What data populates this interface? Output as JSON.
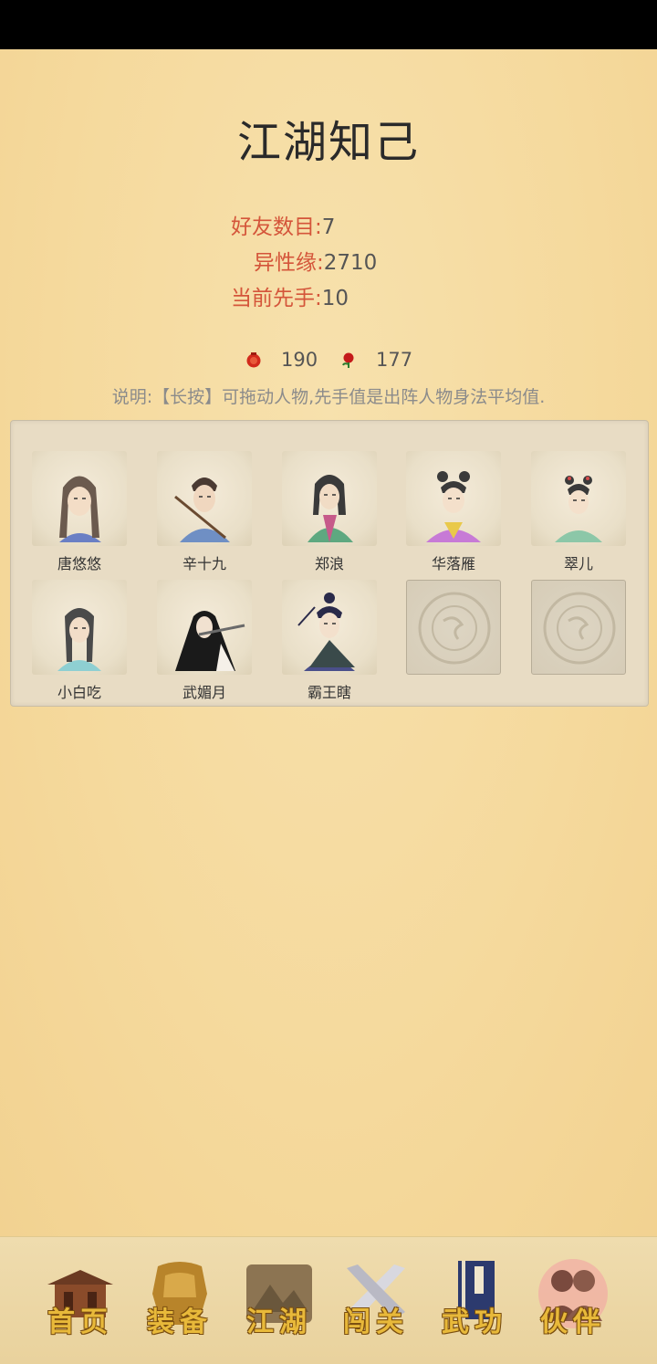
{
  "title": "江湖知己",
  "stats": {
    "friends_label": "好友数目:",
    "friends_value": "7",
    "affinity_label": "异性缘:",
    "affinity_value": "2710",
    "initiative_label": "当前先手:",
    "initiative_value": "10"
  },
  "resources": {
    "pouch_count": "190",
    "rose_count": "177"
  },
  "note": "说明:【长按】可拖动人物,先手值是出阵人物身法平均值.",
  "companions": [
    {
      "name": "唐悠悠",
      "icon": "portrait-woman-long-hair"
    },
    {
      "name": "辛十九",
      "icon": "portrait-swordsman"
    },
    {
      "name": "郑浪",
      "icon": "portrait-green-robe"
    },
    {
      "name": "华落雁",
      "icon": "portrait-purple-robe"
    },
    {
      "name": "翠儿",
      "icon": "portrait-maid"
    },
    {
      "name": "小白吃",
      "icon": "portrait-girl-braids"
    },
    {
      "name": "武媚月",
      "icon": "portrait-flute-player"
    },
    {
      "name": "霸王瞎",
      "icon": "portrait-fan-man"
    }
  ],
  "empty_slots": 2,
  "nav": [
    {
      "label": "首页",
      "icon": "house-icon"
    },
    {
      "label": "装备",
      "icon": "armor-icon"
    },
    {
      "label": "江湖",
      "icon": "scroll-map-icon"
    },
    {
      "label": "闯关",
      "icon": "swords-icon"
    },
    {
      "label": "武功",
      "icon": "book-icon"
    },
    {
      "label": "伙伴",
      "icon": "partners-icon"
    }
  ],
  "colors": {
    "stat_label": "#d4553a",
    "background": "#f7dba0",
    "nav_text": "#e8b93a"
  }
}
